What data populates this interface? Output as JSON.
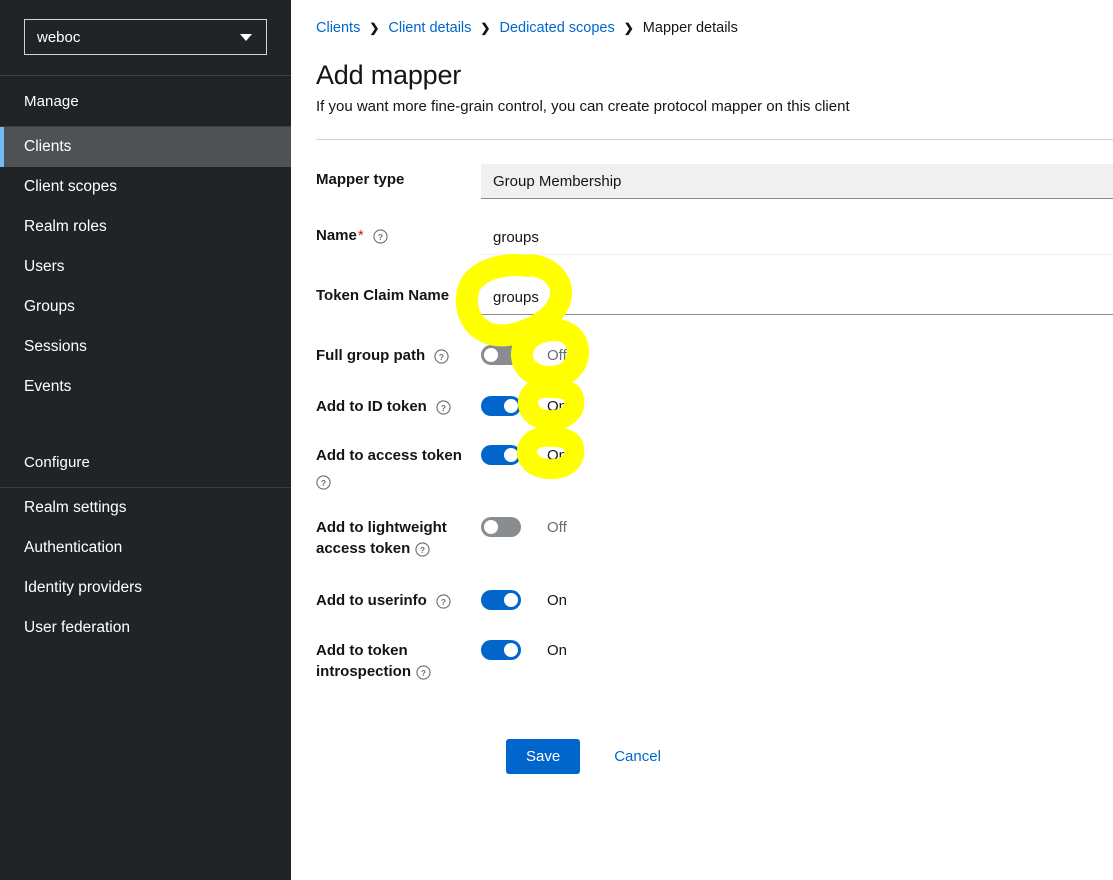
{
  "sidebar": {
    "realm_selector": {
      "value": "weboc",
      "icon": "chevron-down-icon"
    },
    "groups": [
      {
        "title": "Manage",
        "items": [
          {
            "label": "Clients",
            "active": true
          },
          {
            "label": "Client scopes",
            "active": false
          },
          {
            "label": "Realm roles",
            "active": false
          },
          {
            "label": "Users",
            "active": false
          },
          {
            "label": "Groups",
            "active": false
          },
          {
            "label": "Sessions",
            "active": false
          },
          {
            "label": "Events",
            "active": false
          }
        ]
      },
      {
        "title": "Configure",
        "items": [
          {
            "label": "Realm settings",
            "active": false
          },
          {
            "label": "Authentication",
            "active": false
          },
          {
            "label": "Identity providers",
            "active": false
          },
          {
            "label": "User federation",
            "active": false
          }
        ]
      }
    ]
  },
  "header": {
    "breadcrumb": [
      {
        "label": "Clients",
        "link": true
      },
      {
        "label": "Client details",
        "link": true
      },
      {
        "label": "Dedicated scopes",
        "link": true
      },
      {
        "label": "Mapper details",
        "link": false
      }
    ],
    "breadcrumb_separator": "❯",
    "title": "Add mapper",
    "subtitle": "If you want more fine-grain control, you can create protocol mapper on this client"
  },
  "form": {
    "mapper_type": {
      "label": "Mapper type",
      "value": "Group Membership",
      "disabled": true
    },
    "name": {
      "label": "Name",
      "required_marker": "*",
      "value": "groups",
      "help_icon": "help-circle-icon"
    },
    "token_claim_name": {
      "label": "Token Claim Name",
      "value": "groups",
      "help_icon": "help-circle-icon"
    },
    "toggles": [
      {
        "label": "Full group path",
        "state_label": "Off",
        "on": false,
        "help_icon": "help-circle-icon",
        "help_below": false
      },
      {
        "label": "Add to ID token",
        "state_label": "On",
        "on": true,
        "help_icon": "help-circle-icon",
        "help_below": false
      },
      {
        "label": "Add to access token",
        "state_label": "On",
        "on": true,
        "help_icon": "help-circle-icon",
        "help_below": true
      },
      {
        "label": "Add to lightweight access token",
        "state_label": "Off",
        "on": false,
        "help_icon": "help-circle-icon",
        "help_below": true
      },
      {
        "label": "Add to userinfo",
        "state_label": "On",
        "on": true,
        "help_icon": "help-circle-icon",
        "help_below": false
      },
      {
        "label": "Add to token introspection",
        "state_label": "On",
        "on": true,
        "help_icon": "help-circle-icon",
        "help_below": true
      }
    ],
    "actions": {
      "save_label": "Save",
      "cancel_label": "Cancel"
    }
  },
  "colors": {
    "sidebar_bg": "#212427",
    "sidebar_active_bg": "#4f5255",
    "active_accent": "#73bcf7",
    "link": "#0066cc",
    "primary_button": "#0066cc",
    "toggle_on": "#0066cc",
    "toggle_off": "#8a8d90",
    "required_marker": "#c9190b",
    "highlight_marker": "#ffff00",
    "disabled_field_bg": "#f0f0f0"
  },
  "annotations": {
    "marker_color": "#ffff00",
    "marks": [
      {
        "name": "highlight-token-claim-name",
        "target": "token_claim_name_value"
      },
      {
        "name": "highlight-full-group-path-off",
        "target": "full_group_path_state"
      },
      {
        "name": "highlight-add-id-token-on",
        "target": "add_id_token_state"
      },
      {
        "name": "highlight-add-access-token-on",
        "target": "add_access_token_state"
      }
    ]
  }
}
